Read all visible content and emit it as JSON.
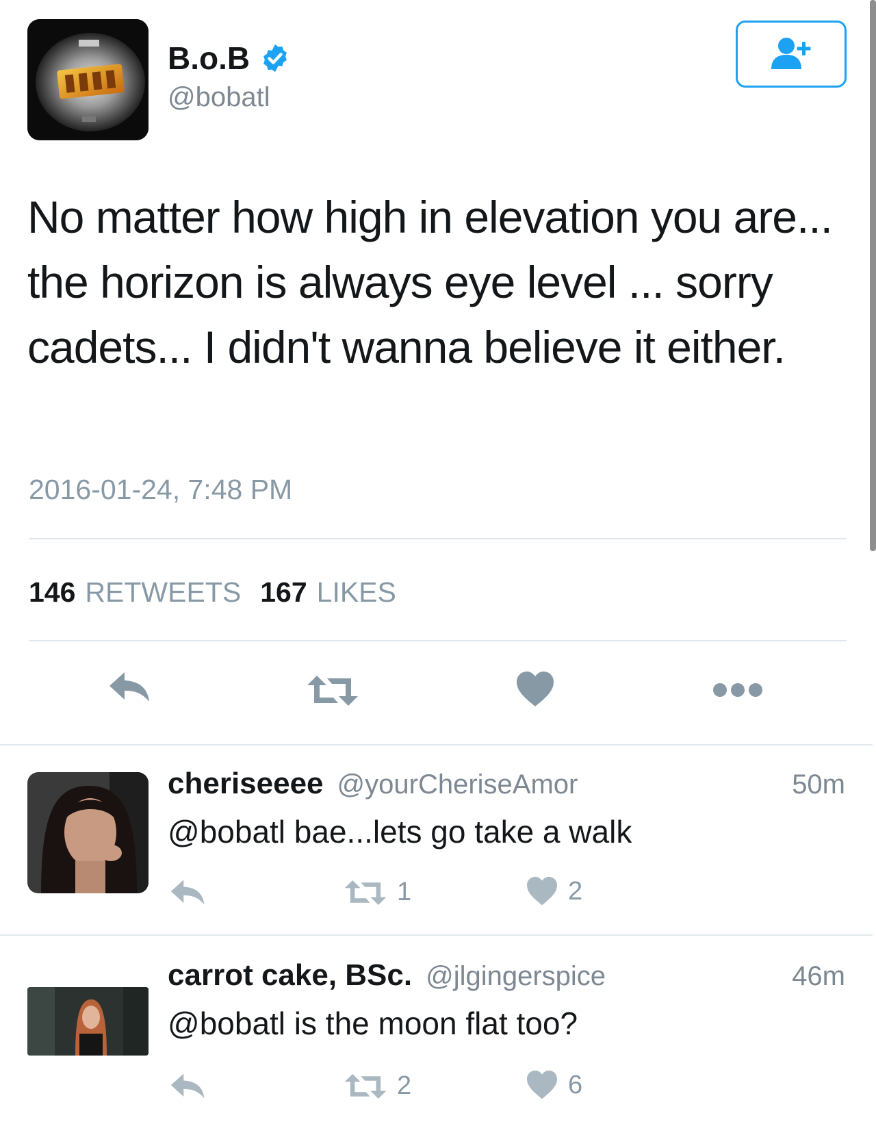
{
  "tweet": {
    "author_name": "B.o.B",
    "author_handle": "@bobatl",
    "verified": true,
    "avatar_icon": "album-cover-avatar",
    "text": "No matter how high in elevation you are... the horizon is always eye level ... sorry cadets... I didn't wanna believe it either.",
    "timestamp": "2016-01-24, 7:48 PM",
    "retweet_count": "146",
    "retweet_label": "RETWEETS",
    "like_count": "167",
    "like_label": "LIKES",
    "follow_icon": "add-user-icon",
    "actions": [
      "reply-icon",
      "retweet-icon",
      "like-icon",
      "more-icon"
    ]
  },
  "colors": {
    "accent": "#1da1f2",
    "icon_gray": "#8899a6",
    "text_primary": "#14171a",
    "text_secondary": "#7d8892",
    "divider": "#e1e8ed"
  },
  "replies": [
    {
      "name": "cheriseeee",
      "handle": "@yourCheriseAmor",
      "time": "50m",
      "text": "@bobatl bae...lets go take a walk",
      "retweets": "1",
      "likes": "2"
    },
    {
      "name": "carrot cake, BSc.",
      "handle": "@jlgingerspice",
      "time": "46m",
      "text": "@bobatl is the moon flat too?",
      "retweets": "2",
      "likes": "6"
    }
  ]
}
